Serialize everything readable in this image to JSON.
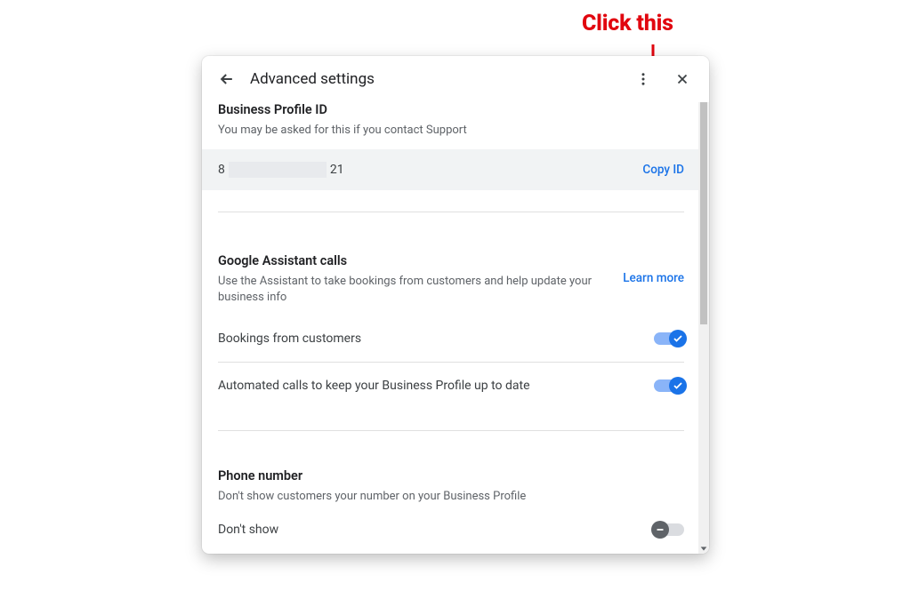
{
  "annotation": {
    "text": "Click this"
  },
  "header": {
    "title": "Advanced settings"
  },
  "profile_id": {
    "section_title": "Business Profile ID",
    "section_desc": "You may be asked for this if you contact Support",
    "value_prefix": "8",
    "value_suffix": "21",
    "copy_label": "Copy ID"
  },
  "assistant": {
    "section_title": "Google Assistant calls",
    "section_desc": "Use the Assistant to take bookings from customers and help update your business info",
    "learn_more": "Learn more",
    "rows": [
      {
        "label": "Bookings from customers"
      },
      {
        "label": "Automated calls to keep your Business Profile up to date"
      }
    ]
  },
  "phone": {
    "section_title": "Phone number",
    "section_desc": "Don't show customers your number on your Business Profile",
    "row_label": "Don't show"
  }
}
